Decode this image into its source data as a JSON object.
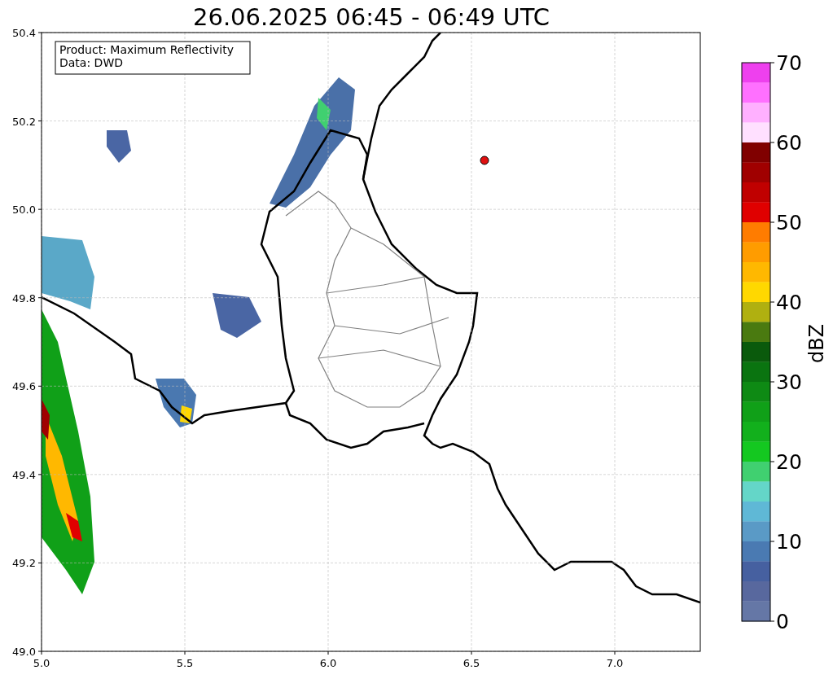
{
  "title": "26.06.2025 06:45 - 06:49 UTC",
  "info_box": {
    "lines": [
      "Product: Maximum Reflectivity",
      "Data: DWD"
    ]
  },
  "x_axis": {
    "ticks": [
      "5.0",
      "5.5",
      "6.0",
      "6.5",
      "7.0"
    ]
  },
  "y_axis": {
    "ticks": [
      "50.4",
      "50.2",
      "50.0",
      "49.8",
      "49.6",
      "49.4",
      "49.2",
      "49.0"
    ]
  },
  "colorbar": {
    "label": "dBZ",
    "ticks": [
      "70",
      "60",
      "50",
      "40",
      "30",
      "20",
      "10",
      "0"
    ],
    "segments": [
      {
        "color": "#ee40ee"
      },
      {
        "color": "#ff70ff"
      },
      {
        "color": "#ffb0ff"
      },
      {
        "color": "#ffe0ff"
      },
      {
        "color": "#800000"
      },
      {
        "color": "#a00000"
      },
      {
        "color": "#c00000"
      },
      {
        "color": "#e00000"
      },
      {
        "color": "#ff7c00"
      },
      {
        "color": "#ff9c00"
      },
      {
        "color": "#ffb800"
      },
      {
        "color": "#ffd800"
      },
      {
        "color": "#b0b010"
      },
      {
        "color": "#4a7a10"
      },
      {
        "color": "#0a5a0c"
      },
      {
        "color": "#0a7410"
      },
      {
        "color": "#0e8a14"
      },
      {
        "color": "#10a018"
      },
      {
        "color": "#12b01c"
      },
      {
        "color": "#14c820"
      },
      {
        "color": "#40d070"
      },
      {
        "color": "#64d6c8"
      },
      {
        "color": "#5fb8d6"
      },
      {
        "color": "#5a9ac6"
      },
      {
        "color": "#4a7ab2"
      },
      {
        "color": "#4660a0"
      },
      {
        "color": "#58689e"
      },
      {
        "color": "#6577a6"
      }
    ]
  }
}
